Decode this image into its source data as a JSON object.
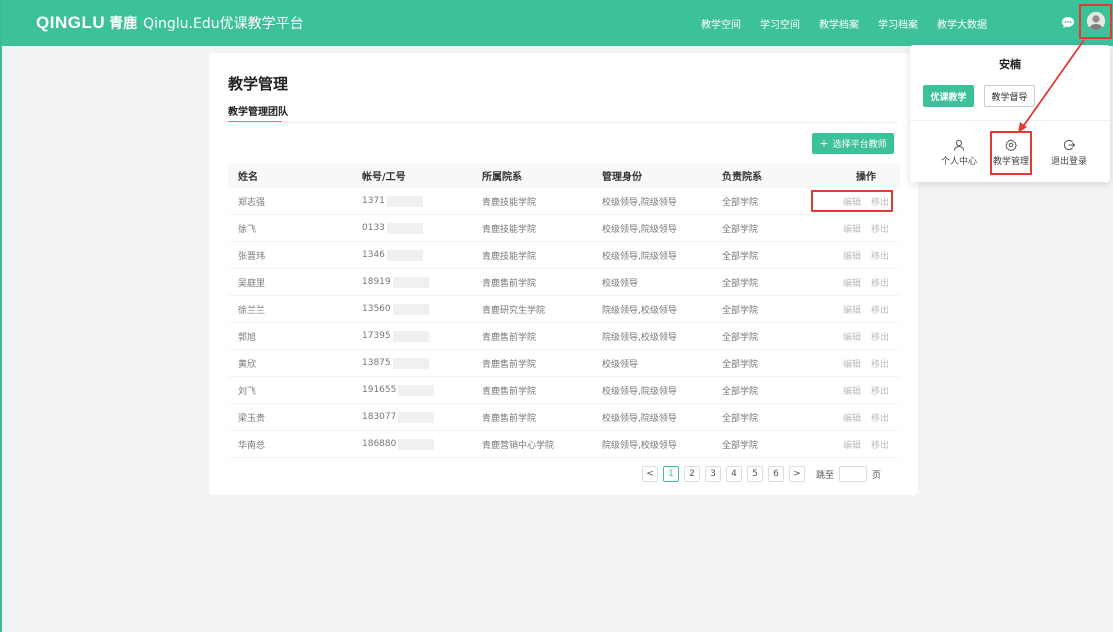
{
  "brand": {
    "logo": "QINGLU",
    "cn": "青鹿",
    "sub": "Qinglu.Edu优课教学平台"
  },
  "nav": [
    "教学空间",
    "学习空间",
    "教学档案",
    "学习档案",
    "教学大数据"
  ],
  "colors": {
    "primary": "#3cc19a",
    "highlight": "#e53935"
  },
  "page": {
    "title": "教学管理",
    "tab": "教学管理团队",
    "add_button": "选择平台教师",
    "add_icon": "+"
  },
  "table": {
    "headers": [
      "姓名",
      "帐号/工号",
      "所属院系",
      "管理身份",
      "负责院系",
      "操作"
    ],
    "rows": [
      {
        "name": "郑志强",
        "id": "1371",
        "dept": "青鹿技能学院",
        "role": "校级领导,院级领导",
        "resp": "全部学院"
      },
      {
        "name": "徐飞",
        "id": "0133",
        "dept": "青鹿技能学院",
        "role": "校级领导,院级领导",
        "resp": "全部学院"
      },
      {
        "name": "张晋玮",
        "id": "1346",
        "dept": "青鹿技能学院",
        "role": "校级领导,院级领导",
        "resp": "全部学院"
      },
      {
        "name": "吴庭里",
        "id": "18919",
        "dept": "青鹿售前学院",
        "role": "校级领导",
        "resp": "全部学院"
      },
      {
        "name": "徐兰兰",
        "id": "13560",
        "dept": "青鹿研究生学院",
        "role": "院级领导,校级领导",
        "resp": "全部学院"
      },
      {
        "name": "郭旭",
        "id": "17395",
        "dept": "青鹿售前学院",
        "role": "院级领导,校级领导",
        "resp": "全部学院"
      },
      {
        "name": "黄欣",
        "id": "13875",
        "dept": "青鹿售前学院",
        "role": "校级领导",
        "resp": "全部学院"
      },
      {
        "name": "刘飞",
        "id": "191655",
        "dept": "青鹿售前学院",
        "role": "校级领导,院级领导",
        "resp": "全部学院"
      },
      {
        "name": "梁玉贵",
        "id": "183077",
        "dept": "青鹿售前学院",
        "role": "校级领导,院级领导",
        "resp": "全部学院"
      },
      {
        "name": "华南总",
        "id": "186880",
        "dept": "青鹿营销中心学院",
        "role": "院级领导,校级领导",
        "resp": "全部学院"
      }
    ],
    "edit": "编辑",
    "remove": "移出"
  },
  "pager": {
    "prev": "<",
    "pages": [
      "1",
      "2",
      "3",
      "4",
      "5",
      "6"
    ],
    "next": ">",
    "current": "1",
    "jump_label": "跳至",
    "page_suffix": "页"
  },
  "dropdown": {
    "user": "安楠",
    "btn_primary": "优课教学",
    "btn_secondary": "教学督导",
    "items": [
      {
        "label": "个人中心",
        "icon": "user-icon"
      },
      {
        "label": "教学管理",
        "icon": "gear-icon"
      },
      {
        "label": "退出登录",
        "icon": "logout-icon"
      }
    ]
  }
}
